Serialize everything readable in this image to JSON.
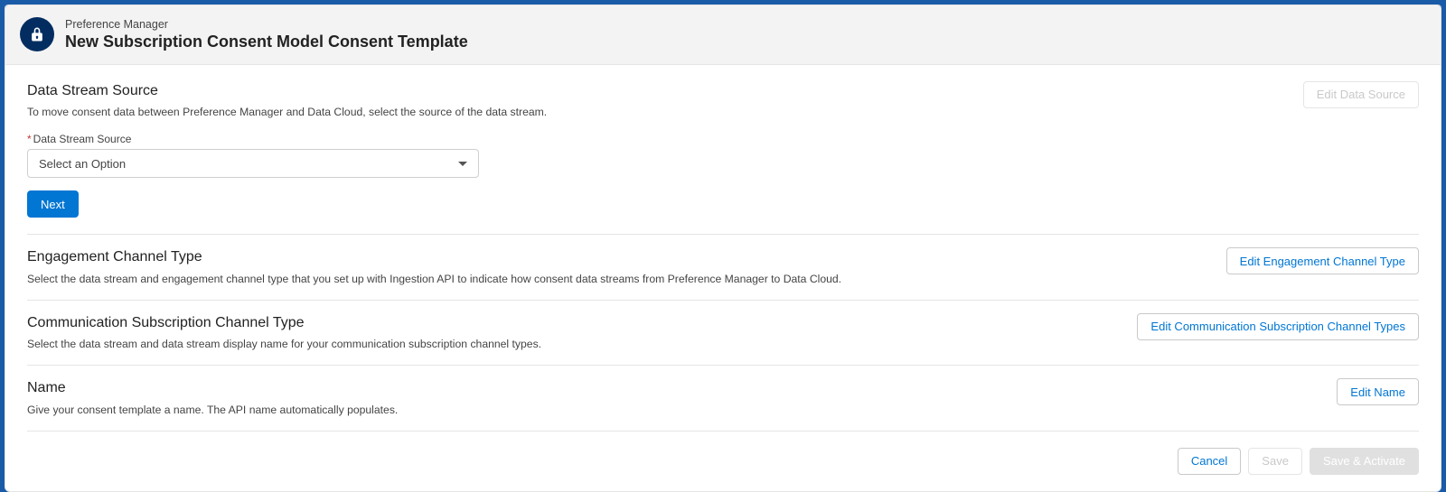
{
  "header": {
    "eyebrow": "Preference Manager",
    "title": "New Subscription Consent Model Consent Template"
  },
  "sections": {
    "dataStream": {
      "title": "Data Stream Source",
      "desc": "To move consent data between Preference Manager and Data Cloud, select the source of the data stream.",
      "editButton": "Edit Data Source",
      "field": {
        "label": "Data Stream Source",
        "placeholder": "Select an Option"
      },
      "nextButton": "Next"
    },
    "engagement": {
      "title": "Engagement Channel Type",
      "desc": "Select the data stream and engagement channel type that you set up with Ingestion API to indicate how consent data streams from Preference Manager to Data Cloud.",
      "editButton": "Edit Engagement Channel Type"
    },
    "commSub": {
      "title": "Communication Subscription Channel Type",
      "desc": "Select the data stream and data stream display name for your communication subscription channel types.",
      "editButton": "Edit Communication Subscription Channel Types"
    },
    "name": {
      "title": "Name",
      "desc": "Give your consent template a name. The API name automatically populates.",
      "editButton": "Edit Name"
    }
  },
  "footer": {
    "cancel": "Cancel",
    "save": "Save",
    "saveActivate": "Save & Activate"
  }
}
